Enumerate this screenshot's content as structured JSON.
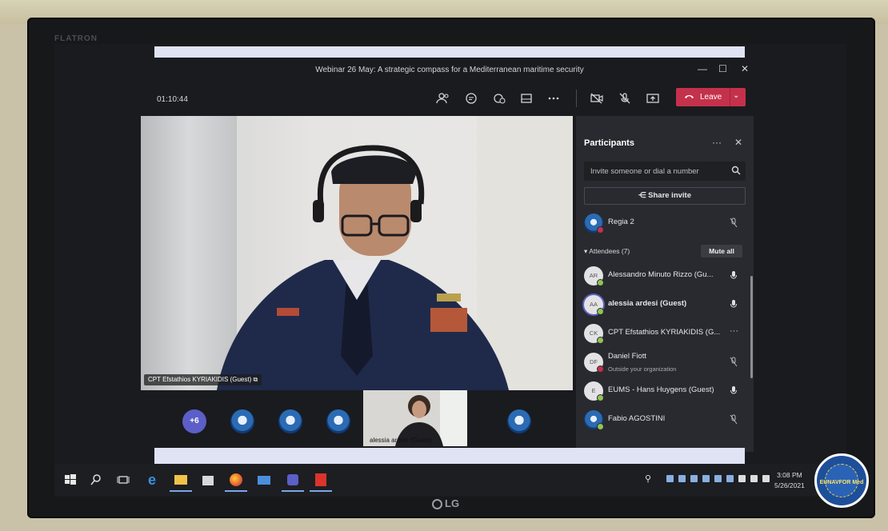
{
  "monitor": {
    "brand": "FLATRON",
    "maker": "LG"
  },
  "window": {
    "title": "Webinar 26 May: A strategic compass for a Mediterranean maritime security"
  },
  "toolbar": {
    "timer": "01:10:44",
    "leave_label": "Leave"
  },
  "main_video": {
    "name_label": "CPT Efstathios KYRIAKIDIS (Guest)"
  },
  "thumbnails": {
    "overflow_count": "+6",
    "self_label": "alessia ardesi (Guest)"
  },
  "participants": {
    "title": "Participants",
    "invite_placeholder": "Invite someone or dial a number",
    "share_invite": "Share invite",
    "organizer": {
      "name": "Regia 2"
    },
    "attendees_header": "Attendees (7)",
    "mute_all": "Mute all",
    "attendees": [
      {
        "initials": "AR",
        "name": "Alessandro Minuto Rizzo (Gu..."
      },
      {
        "initials": "AA",
        "name": "alessia ardesi (Guest)"
      },
      {
        "initials": "CK",
        "name": "CPT Efstathios KYRIAKIDIS (G..."
      },
      {
        "initials": "DF",
        "name": "Daniel Fiott",
        "subtitle": "Outside your organization"
      },
      {
        "initials": "E",
        "name": "EUMS - Hans Huygens (Guest)"
      },
      {
        "initials": "",
        "name": "Fabio AGOSTINI"
      }
    ]
  },
  "taskbar": {
    "time": "3:08 PM",
    "date": "5/26/2021"
  },
  "watermark": {
    "text": "EUNAVFOR Med"
  },
  "colors": {
    "leave": "#c4314b",
    "accent": "#5b5fc7",
    "panel": "#292a2f"
  }
}
